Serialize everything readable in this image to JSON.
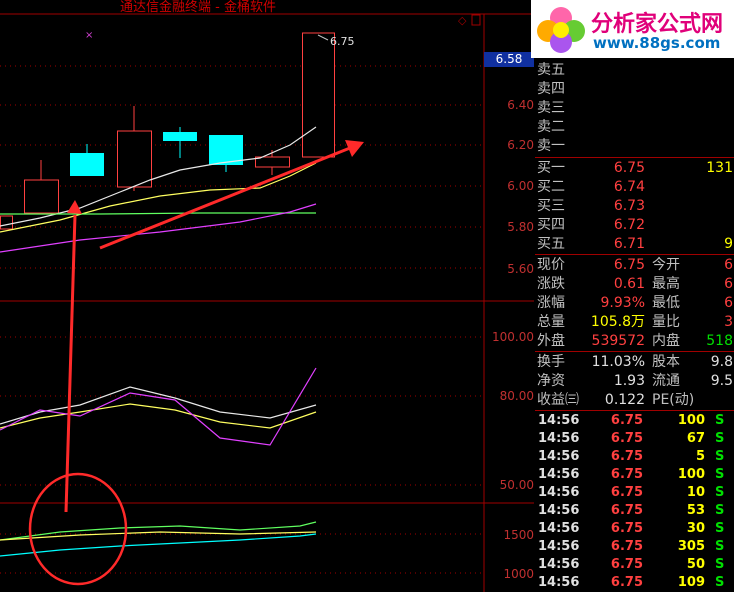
{
  "window": {
    "title": "通达信金融终端 - 金桶软件"
  },
  "chart_markers": {
    "high_label": "6.75",
    "current_price_tag": "6.58"
  },
  "logo": {
    "title": "分析家公式网",
    "url": "www.88gs.com"
  },
  "main_axis": {
    "ticks": [
      "6.40",
      "6.20",
      "6.00",
      "5.80",
      "5.60"
    ]
  },
  "ind1_axis": {
    "ticks": [
      "100.00",
      "80.00",
      "50.00"
    ]
  },
  "ind2_axis": {
    "ticks": [
      "1500",
      "1000"
    ]
  },
  "order_book": {
    "sells": [
      {
        "label": "卖五",
        "price": "",
        "vol": ""
      },
      {
        "label": "卖四",
        "price": "",
        "vol": ""
      },
      {
        "label": "卖三",
        "price": "",
        "vol": ""
      },
      {
        "label": "卖二",
        "price": "",
        "vol": ""
      },
      {
        "label": "卖一",
        "price": "",
        "vol": ""
      }
    ],
    "buys": [
      {
        "label": "买一",
        "price": "6.75",
        "vol": "131"
      },
      {
        "label": "买二",
        "price": "6.74",
        "vol": ""
      },
      {
        "label": "买三",
        "price": "6.73",
        "vol": ""
      },
      {
        "label": "买四",
        "price": "6.72",
        "vol": ""
      },
      {
        "label": "买五",
        "price": "6.71",
        "vol": "9"
      }
    ]
  },
  "quote": [
    {
      "l1": "现价",
      "v1": "6.75",
      "l2": "今开",
      "v2": "6"
    },
    {
      "l1": "涨跌",
      "v1": "0.61",
      "l2": "最高",
      "v2": "6"
    },
    {
      "l1": "涨幅",
      "v1": "9.93%",
      "l2": "最低",
      "v2": "6"
    },
    {
      "l1": "总量",
      "v1": "105.8万",
      "l2": "量比",
      "v2": "3"
    },
    {
      "l1": "外盘",
      "v1": "539572",
      "l2": "内盘",
      "v2": "518"
    }
  ],
  "fundamentals": [
    {
      "l1": "换手",
      "v1": "11.03%",
      "l2": "股本",
      "v2": "9.8"
    },
    {
      "l1": "净资",
      "v1": "1.93",
      "l2": "流通",
      "v2": "9.5"
    },
    {
      "l1": "收益㈢",
      "v1": "0.122",
      "l2": "PE(动)",
      "v2": ""
    }
  ],
  "trades": [
    {
      "time": "14:56",
      "price": "6.75",
      "vol": "100",
      "side": "S"
    },
    {
      "time": "14:56",
      "price": "6.75",
      "vol": "67",
      "side": "S"
    },
    {
      "time": "14:56",
      "price": "6.75",
      "vol": "5",
      "side": "S"
    },
    {
      "time": "14:56",
      "price": "6.75",
      "vol": "100",
      "side": "S"
    },
    {
      "time": "14:56",
      "price": "6.75",
      "vol": "10",
      "side": "S"
    },
    {
      "time": "14:56",
      "price": "6.75",
      "vol": "53",
      "side": "S"
    },
    {
      "time": "14:56",
      "price": "6.75",
      "vol": "30",
      "side": "S"
    },
    {
      "time": "14:56",
      "price": "6.75",
      "vol": "305",
      "side": "S"
    },
    {
      "time": "14:56",
      "price": "6.75",
      "vol": "50",
      "side": "S"
    },
    {
      "time": "14:56",
      "price": "6.75",
      "vol": "109",
      "side": "S"
    }
  ],
  "colors": {
    "up": "#ff4040",
    "down": "#00ffff",
    "grid": "#a00000",
    "ma_white": "#e8e8e8",
    "ma_yellow": "#ffff60",
    "ma_green": "#60ff60",
    "ma_magenta": "#e040ff",
    "arrow": "#ff2a2a"
  }
}
